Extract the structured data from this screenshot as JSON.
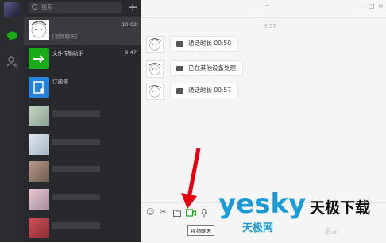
{
  "search": {
    "placeholder": "搜索"
  },
  "chats": [
    {
      "name": "",
      "preview": "[视频聊天]",
      "time": "10:02",
      "active": true
    },
    {
      "name": "文件传输助手",
      "preview": "",
      "time": "9:47"
    },
    {
      "name": "订阅号",
      "preview": "",
      "time": ""
    }
  ],
  "window_controls": {
    "min": "-",
    "max": "□",
    "close": "×"
  },
  "conversation": {
    "timestamp": "9:57",
    "messages": [
      {
        "text": "通话时长 00:50"
      },
      {
        "text": "已在其他设备处理"
      },
      {
        "text": "通话时长 00:57"
      }
    ]
  },
  "toolbar": {
    "tooltip": "视频聊天"
  },
  "watermark": {
    "brand": "yesky",
    "tagline": "天极下载",
    "cn": "天极网",
    "baidu": "Bai"
  },
  "colors": {
    "accent": "#1aad19",
    "arrow": "#e60012",
    "brand_blue": "#1a9bd7"
  }
}
